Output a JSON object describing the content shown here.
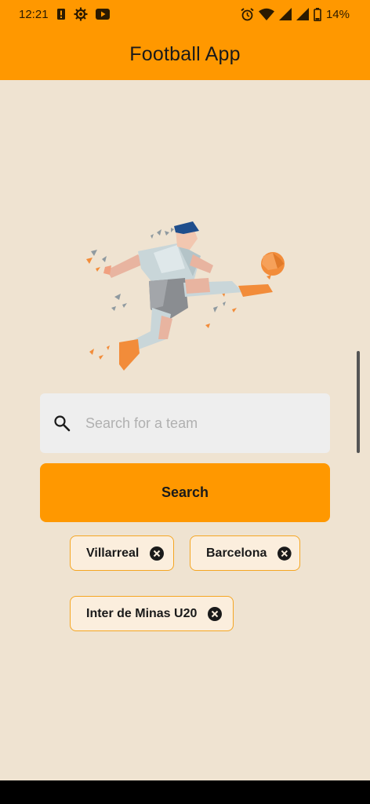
{
  "status_bar": {
    "time": "12:21",
    "battery": "14%",
    "left_icons": [
      "alert-icon",
      "settings-icon",
      "youtube-icon"
    ],
    "right_icons": [
      "alarm-icon",
      "wifi-icon",
      "signal-icon",
      "signal-icon",
      "battery-icon"
    ]
  },
  "app_bar": {
    "title": "Football App"
  },
  "search": {
    "placeholder": "Search for a team",
    "value": "",
    "button_label": "Search"
  },
  "chips": [
    {
      "label": "Villarreal"
    },
    {
      "label": "Barcelona"
    },
    {
      "label": "Inter de Minas U20"
    }
  ],
  "colors": {
    "accent": "#ff9800",
    "background": "#efe3d1",
    "chip_background": "#fbeedd",
    "chip_border": "#f5a623"
  }
}
